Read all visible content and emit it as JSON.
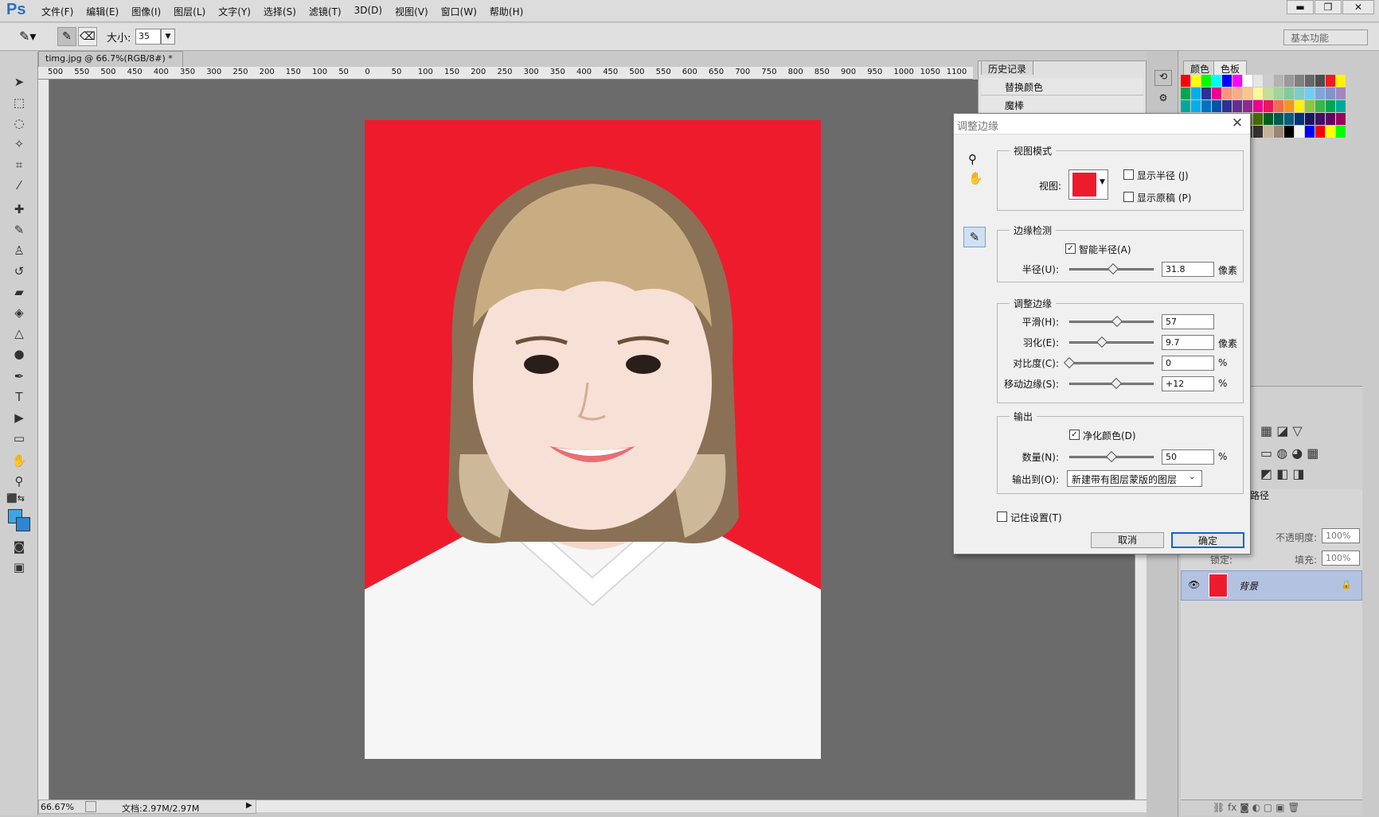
{
  "app": {
    "logo": "Ps"
  },
  "menu": [
    "文件(F)",
    "编辑(E)",
    "图像(I)",
    "图层(L)",
    "文字(Y)",
    "选择(S)",
    "滤镜(T)",
    "3D(D)",
    "视图(V)",
    "窗口(W)",
    "帮助(H)"
  ],
  "window_controls": {
    "minimize": "▬",
    "maximize": "❐",
    "close": "✕"
  },
  "options": {
    "size_label": "大小:",
    "size_value": "35",
    "workspace": "基本功能"
  },
  "document": {
    "tab": "timg.jpg @ 66.7%(RGB/8#) *",
    "tab_close": "×",
    "ruler_ticks": [
      "500",
      "550",
      "500",
      "450",
      "400",
      "350",
      "300",
      "250",
      "200",
      "150",
      "100",
      "50",
      "0",
      "50",
      "100",
      "150",
      "200",
      "250",
      "300",
      "350",
      "400",
      "450",
      "500",
      "550",
      "600",
      "650",
      "700",
      "750",
      "800",
      "850",
      "900",
      "950",
      "1000",
      "1050",
      "1100"
    ]
  },
  "status": {
    "zoom": "66.67%",
    "doc": "文档:2.97M/2.97M"
  },
  "history": {
    "tab": "历史记录",
    "items": [
      "替换颜色",
      "魔棒"
    ]
  },
  "color_panel": {
    "tabs": [
      "颜色",
      "色板"
    ]
  },
  "layers": {
    "opacity_label": "不透明度:",
    "opacity_value": "100%",
    "lock_label": "锁定:",
    "fill_label": "填充:",
    "fill_value": "100%",
    "layer_name": "背景",
    "tab_fragment": "路径"
  },
  "dialog": {
    "title": "调整边缘",
    "close": "✕",
    "view_mode": {
      "group": "视图模式",
      "view_label": "视图:",
      "show_radius": "显示半径 (J)",
      "show_original": "显示原稿 (P)",
      "show_radius_checked": false,
      "show_original_checked": false
    },
    "edge_detection": {
      "group": "边缘检测",
      "smart_radius": "智能半径(A)",
      "smart_radius_checked": true,
      "radius_label": "半径(U):",
      "radius_value": "31.8",
      "radius_unit": "像素",
      "radius_pos": 0.52
    },
    "adjust_edge": {
      "group": "调整边缘",
      "smooth_label": "平滑(H):",
      "smooth_value": "57",
      "smooth_pos": 0.57,
      "feather_label": "羽化(E):",
      "feather_value": "9.7",
      "feather_unit": "像素",
      "feather_pos": 0.39,
      "contrast_label": "对比度(C):",
      "contrast_value": "0",
      "contrast_unit": "%",
      "contrast_pos": 0.0,
      "shift_label": "移动边缘(S):",
      "shift_value": "+12",
      "shift_unit": "%",
      "shift_pos": 0.56
    },
    "output": {
      "group": "输出",
      "decontaminate": "净化颜色(D)",
      "decontaminate_checked": true,
      "amount_label": "数量(N):",
      "amount_value": "50",
      "amount_unit": "%",
      "amount_pos": 0.5,
      "output_to_label": "输出到(O):",
      "output_to_value": "新建带有图层蒙版的图层"
    },
    "remember": "记住设置(T)",
    "remember_checked": false,
    "cancel": "取消",
    "ok": "确定"
  },
  "colors": {
    "accent": "#0a64d6",
    "photo_bg": "#ee1b2d",
    "canvas": "#6b6b6b",
    "layer_selected": "#b3c2e0"
  }
}
